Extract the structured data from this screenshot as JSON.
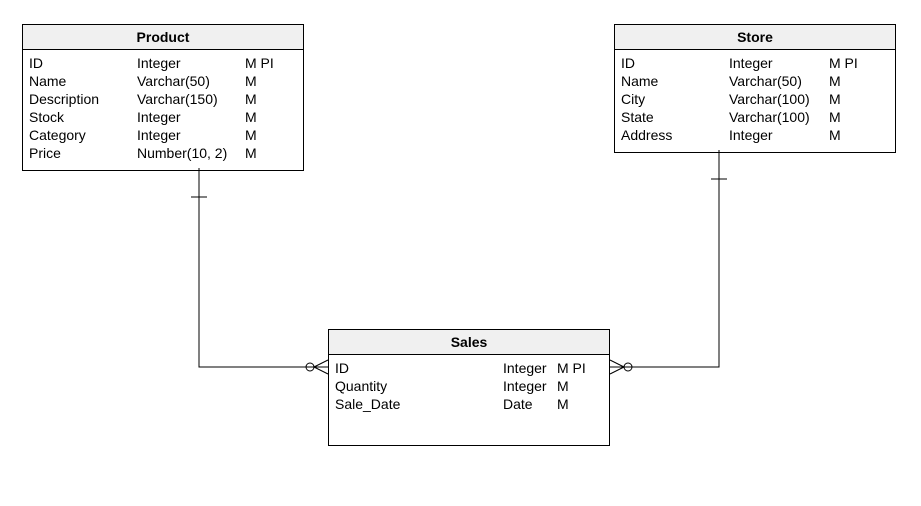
{
  "entities": {
    "product": {
      "title": "Product",
      "attrs": [
        {
          "name": "ID",
          "type": "Integer",
          "flags": "M PI"
        },
        {
          "name": "Name",
          "type": "Varchar(50)",
          "flags": "M"
        },
        {
          "name": "Description",
          "type": "Varchar(150)",
          "flags": "M"
        },
        {
          "name": "Stock",
          "type": "Integer",
          "flags": "M"
        },
        {
          "name": "Category",
          "type": "Integer",
          "flags": "M"
        },
        {
          "name": "Price",
          "type": "Number(10, 2)",
          "flags": "M"
        }
      ]
    },
    "store": {
      "title": "Store",
      "attrs": [
        {
          "name": "ID",
          "type": "Integer",
          "flags": "M PI"
        },
        {
          "name": "Name",
          "type": "Varchar(50)",
          "flags": "M"
        },
        {
          "name": "City",
          "type": "Varchar(100)",
          "flags": "M"
        },
        {
          "name": "State",
          "type": "Varchar(100)",
          "flags": "M"
        },
        {
          "name": "Address",
          "type": "Integer",
          "flags": "M"
        }
      ]
    },
    "sales": {
      "title": "Sales",
      "attrs": [
        {
          "name": "ID",
          "type": "Integer",
          "flags": "M PI"
        },
        {
          "name": "Quantity",
          "type": "Integer",
          "flags": "M"
        },
        {
          "name": "Sale_Date",
          "type": "Date",
          "flags": "M"
        }
      ]
    }
  },
  "relationships": [
    {
      "from": "product",
      "to": "sales",
      "from_card": "one",
      "to_card": "many"
    },
    {
      "from": "store",
      "to": "sales",
      "from_card": "one",
      "to_card": "many"
    }
  ]
}
